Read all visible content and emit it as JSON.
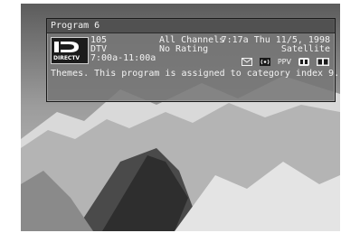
{
  "guide": {
    "header_title": "Program 6",
    "channel_number": "105",
    "channel_name": "DTV",
    "category_top": "All Channels",
    "rating": "No Rating",
    "datetime": "7:17a Thu 11/5, 1998",
    "source": "Satellite",
    "time_range": "7:00a-11:00a",
    "description": "Themes. This program is assigned to category index 9.",
    "logo_text": "DIRECTV",
    "ppv_label": "PPV"
  },
  "icons": [
    "mail-icon",
    "signal-icon",
    "ppv-badge",
    "cc-icon",
    "dolby-icon"
  ]
}
